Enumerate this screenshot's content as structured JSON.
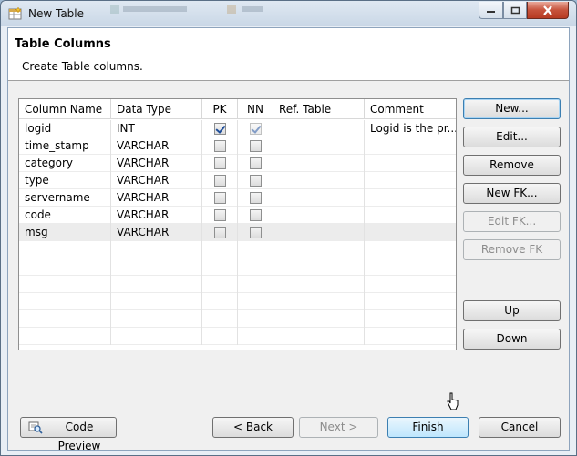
{
  "window": {
    "title": "New Table"
  },
  "header": {
    "title": "Table Columns",
    "description": "Create Table columns."
  },
  "table": {
    "columns": [
      "Column Name",
      "Data Type",
      "PK",
      "NN",
      "Ref. Table",
      "Comment"
    ],
    "rows": [
      {
        "name": "logid",
        "type": "INT",
        "pk": true,
        "nn": true,
        "nn_disabled": true,
        "ref": "",
        "comment": "Logid is the pr..."
      },
      {
        "name": "time_stamp",
        "type": "VARCHAR",
        "pk": false,
        "nn": false,
        "nn_disabled": false,
        "ref": "",
        "comment": ""
      },
      {
        "name": "category",
        "type": "VARCHAR",
        "pk": false,
        "nn": false,
        "nn_disabled": false,
        "ref": "",
        "comment": ""
      },
      {
        "name": "type",
        "type": "VARCHAR",
        "pk": false,
        "nn": false,
        "nn_disabled": false,
        "ref": "",
        "comment": ""
      },
      {
        "name": "servername",
        "type": "VARCHAR",
        "pk": false,
        "nn": false,
        "nn_disabled": false,
        "ref": "",
        "comment": ""
      },
      {
        "name": "code",
        "type": "VARCHAR",
        "pk": false,
        "nn": false,
        "nn_disabled": false,
        "ref": "",
        "comment": ""
      },
      {
        "name": "msg",
        "type": "VARCHAR",
        "pk": false,
        "nn": false,
        "nn_disabled": false,
        "ref": "",
        "comment": "",
        "selected": true
      }
    ]
  },
  "side_buttons": {
    "new": "New...",
    "edit": "Edit...",
    "remove": "Remove",
    "new_fk": "New FK...",
    "edit_fk": "Edit FK...",
    "remove_fk": "Remove FK",
    "up": "Up",
    "down": "Down"
  },
  "footer": {
    "code_preview": "Code Preview",
    "back": "< Back",
    "next": "Next >",
    "finish": "Finish",
    "cancel": "Cancel"
  }
}
